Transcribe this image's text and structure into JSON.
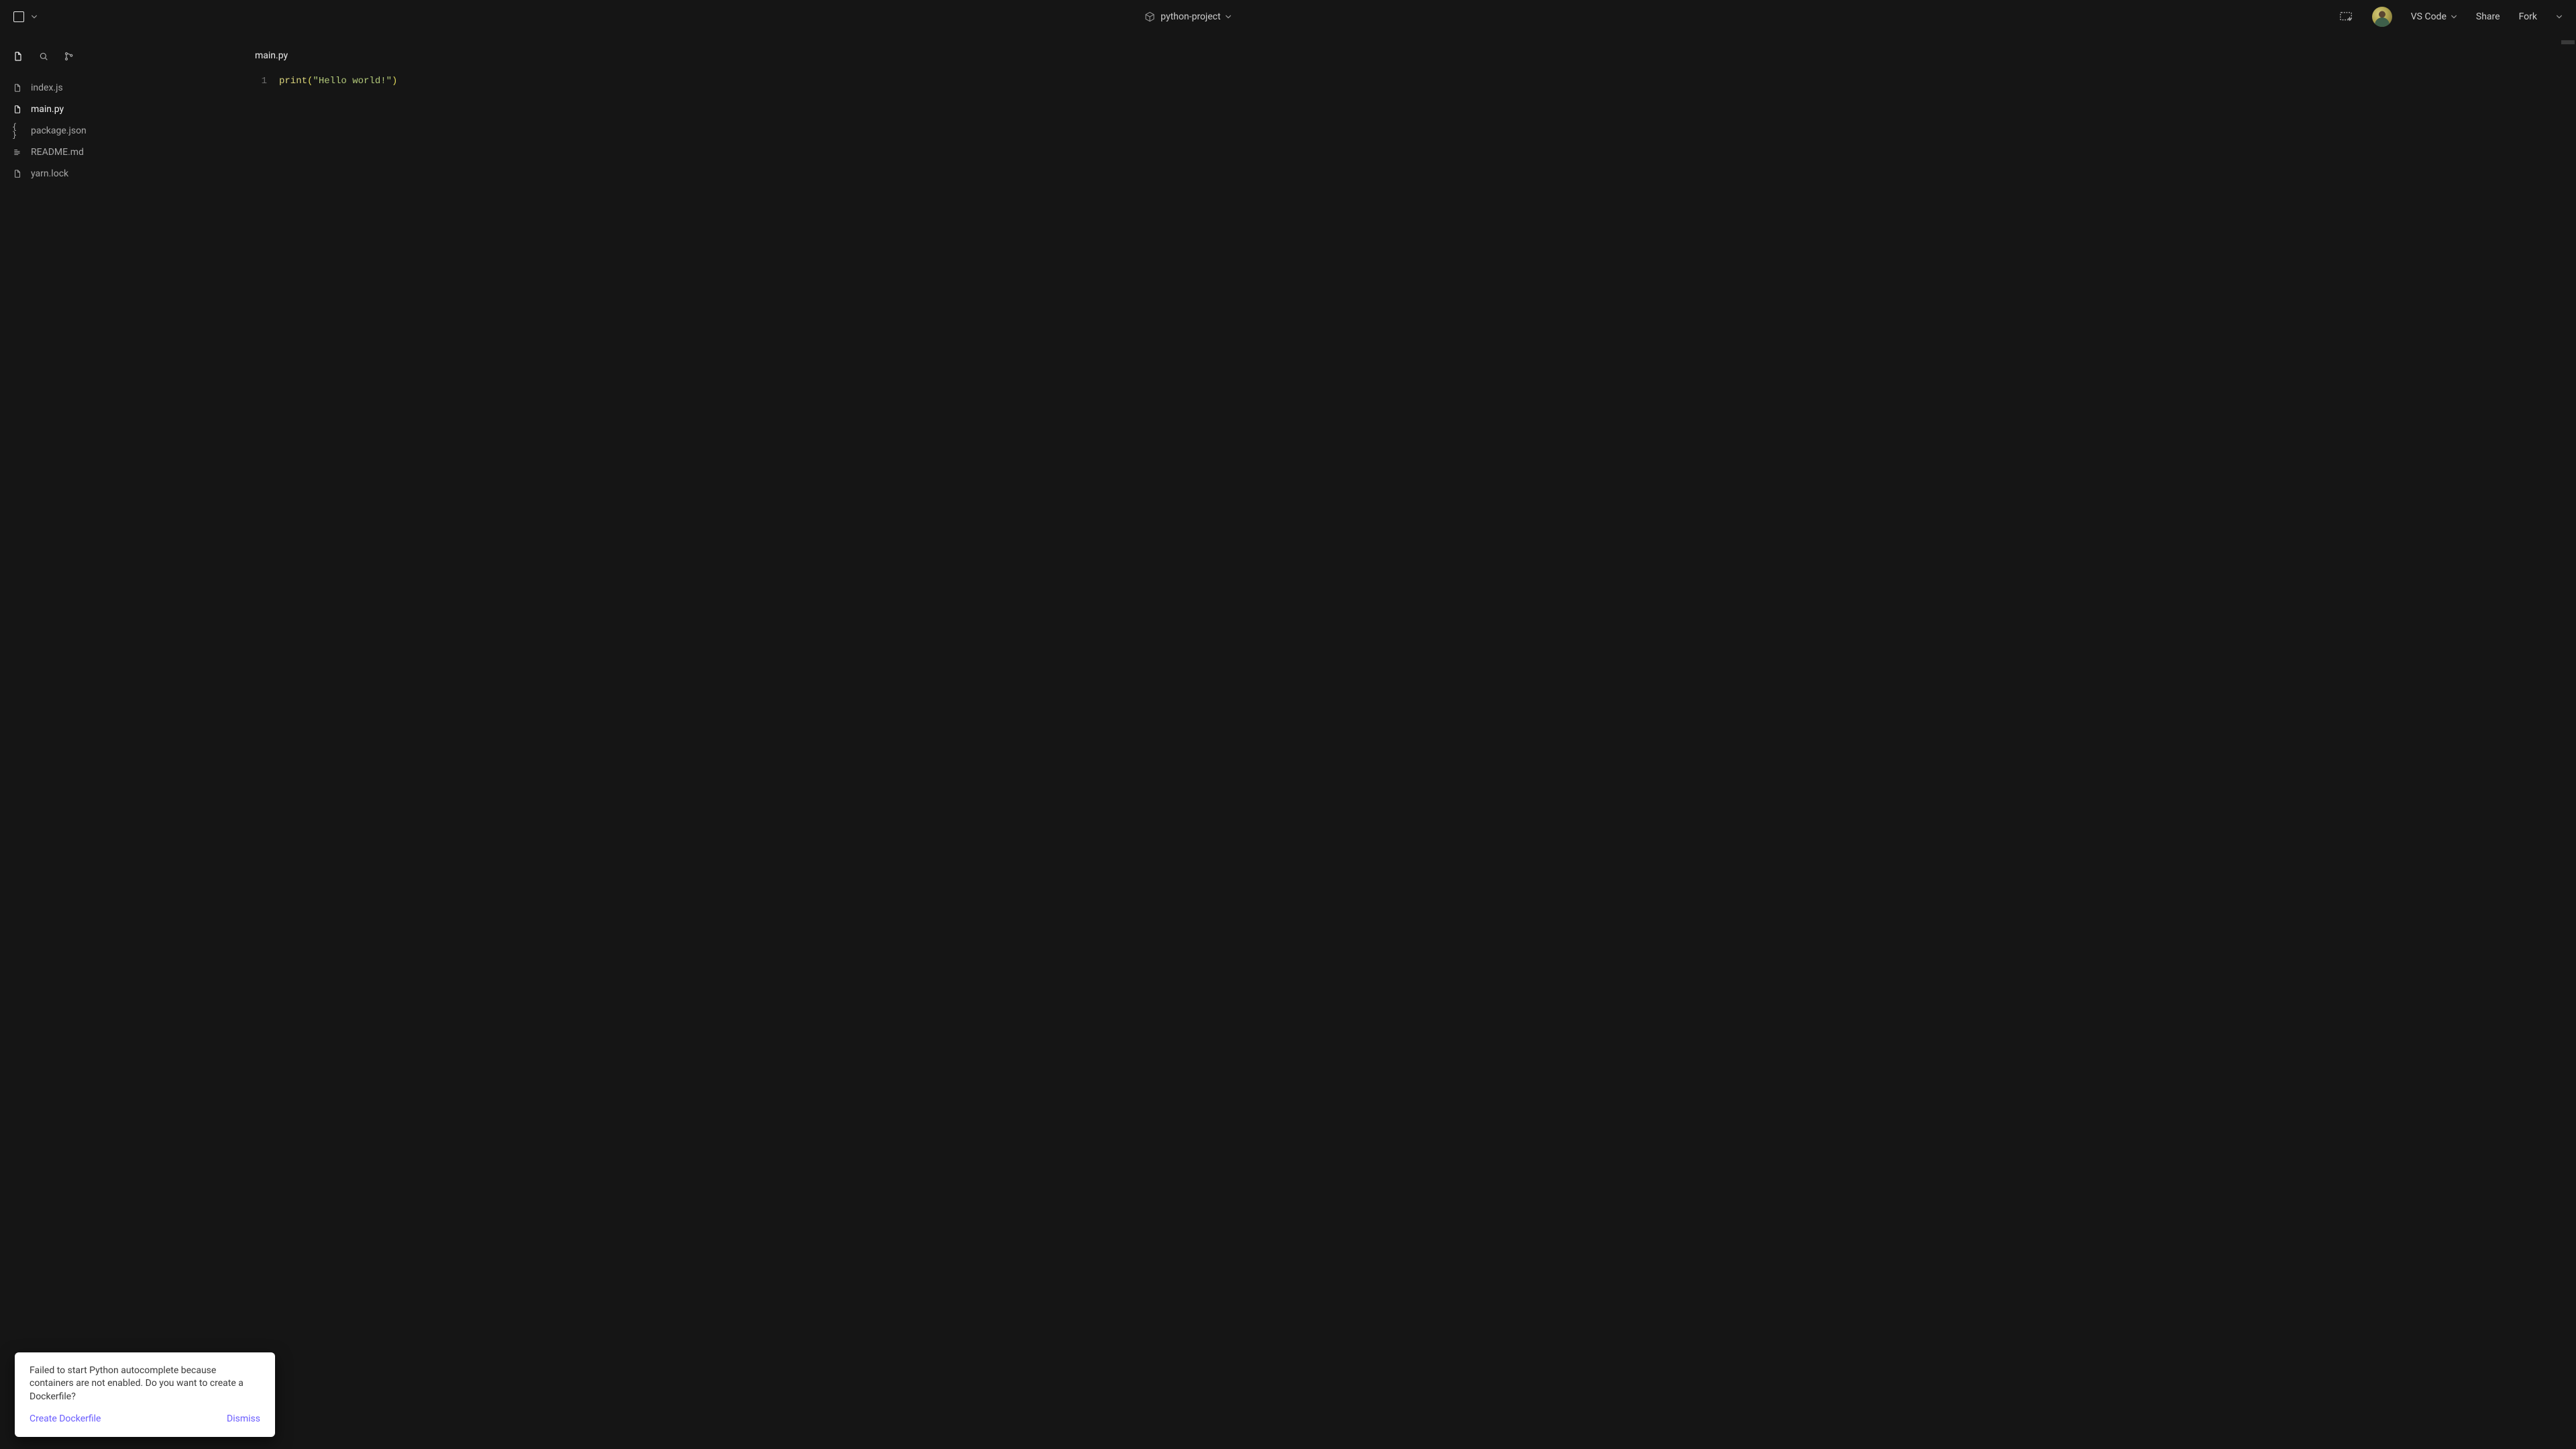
{
  "header": {
    "project_name": "python-project",
    "vscode_label": "VS Code",
    "share_label": "Share",
    "fork_label": "Fork"
  },
  "sidebar": {
    "files": [
      {
        "name": "index.js",
        "icon": "file"
      },
      {
        "name": "main.py",
        "icon": "file",
        "active": true
      },
      {
        "name": "package.json",
        "icon": "braces"
      },
      {
        "name": "README.md",
        "icon": "lines"
      },
      {
        "name": "yarn.lock",
        "icon": "file"
      }
    ]
  },
  "editor": {
    "open_file": "main.py",
    "line_number": "1",
    "tokens": {
      "fn": "print",
      "open": "(",
      "str": "\"Hello world!\"",
      "close": ")"
    }
  },
  "toast": {
    "message": "Failed to start Python autocomplete because containers are not enabled. Do you want to create a Dockerfile?",
    "primary": "Create Dockerfile",
    "secondary": "Dismiss"
  }
}
